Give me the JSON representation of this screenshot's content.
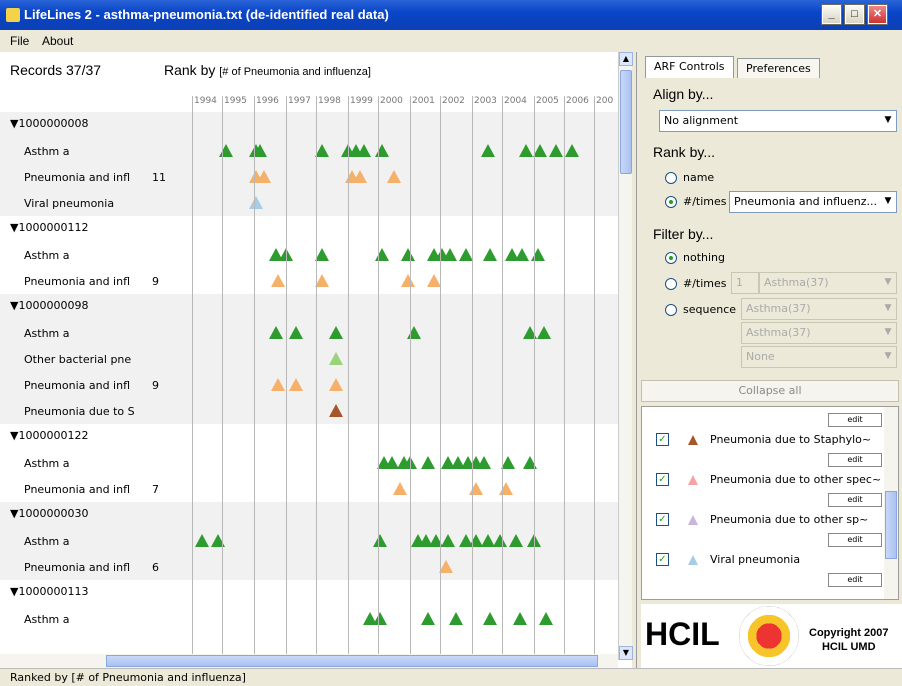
{
  "window": {
    "title": "LifeLines 2 - asthma-pneumonia.txt (de-identified real data)"
  },
  "menu": {
    "file": "File",
    "about": "About"
  },
  "header": {
    "records": "Records 37/37",
    "rank_prefix": "Rank by",
    "rank_detail": "[# of Pneumonia and influenza]"
  },
  "years": [
    "1994",
    "1995",
    "1996",
    "1997",
    "1998",
    "1999",
    "2000",
    "2001",
    "2002",
    "2003",
    "2004",
    "2005",
    "2006",
    "200"
  ],
  "colors": {
    "asthma": "#2e9b2e",
    "pneumonia_infl": "#f5b06a",
    "viral": "#a7cce6",
    "other_bacterial": "#9bd37a",
    "staph": "#a6562a",
    "other_spec": "#f5a2a2",
    "other_sp": "#c9b4dc"
  },
  "records": [
    {
      "id": "▼1000000008",
      "rows": [
        {
          "label": "Asthm a",
          "count": "",
          "color": "asthma"
        },
        {
          "label": "Pneumonia and infl",
          "count": "11",
          "color": "pneumonia_infl"
        },
        {
          "label": "Viral pneumonia",
          "count": "",
          "color": "viral"
        }
      ]
    },
    {
      "id": "▼1000000112",
      "rows": [
        {
          "label": "Asthm a",
          "count": "",
          "color": "asthma"
        },
        {
          "label": "Pneumonia and infl",
          "count": "9",
          "color": "pneumonia_infl"
        }
      ]
    },
    {
      "id": "▼1000000098",
      "rows": [
        {
          "label": "Asthm a",
          "count": "",
          "color": "asthma"
        },
        {
          "label": "Other bacterial pne",
          "count": "",
          "color": "other_bacterial"
        },
        {
          "label": "Pneumonia and infl",
          "count": "9",
          "color": "pneumonia_infl"
        },
        {
          "label": "Pneumonia due to S",
          "count": "",
          "color": "staph"
        }
      ]
    },
    {
      "id": "▼1000000122",
      "rows": [
        {
          "label": "Asthm a",
          "count": "",
          "color": "asthma"
        },
        {
          "label": "Pneumonia and infl",
          "count": "7",
          "color": "pneumonia_infl"
        }
      ]
    },
    {
      "id": "▼1000000030",
      "rows": [
        {
          "label": "Asthm a",
          "count": "",
          "color": "asthma"
        },
        {
          "label": "Pneumonia and infl",
          "count": "6",
          "color": "pneumonia_infl"
        }
      ]
    },
    {
      "id": "▼1000000113",
      "rows": [
        {
          "label": "Asthm a",
          "count": "",
          "color": "asthma"
        }
      ]
    }
  ],
  "tabs": {
    "arf": "ARF Controls",
    "prefs": "Preferences"
  },
  "align": {
    "title": "Align by...",
    "value": "No alignment"
  },
  "rank": {
    "title": "Rank by...",
    "opt_name": "name",
    "opt_times": "#/times",
    "value": "Pneumonia and influenz..."
  },
  "filter": {
    "title": "Filter by...",
    "opt_nothing": "nothing",
    "opt_times": "#/times",
    "opt_sequence": "sequence",
    "times_num": "1",
    "times_value": "Asthma(37)",
    "seq1": "Asthma(37)",
    "seq2": "Asthma(37)",
    "seq3": "None"
  },
  "collapse_label": "Collapse all",
  "events": [
    {
      "label": "Pneumonia due to Staphylo~",
      "color": "staph",
      "edit": "edit"
    },
    {
      "label": "Pneumonia due to other spec~",
      "color": "other_spec",
      "edit": "edit"
    },
    {
      "label": "Pneumonia due to other sp~",
      "color": "other_sp",
      "edit": "edit"
    },
    {
      "label": "Viral pneumonia",
      "color": "viral",
      "edit": "edit"
    }
  ],
  "logo": {
    "hcil": "HCIL",
    "copyright": "Copyright 2007",
    "org": "HCIL UMD"
  },
  "status": "Ranked by [# of Pneumonia and influenza]"
}
